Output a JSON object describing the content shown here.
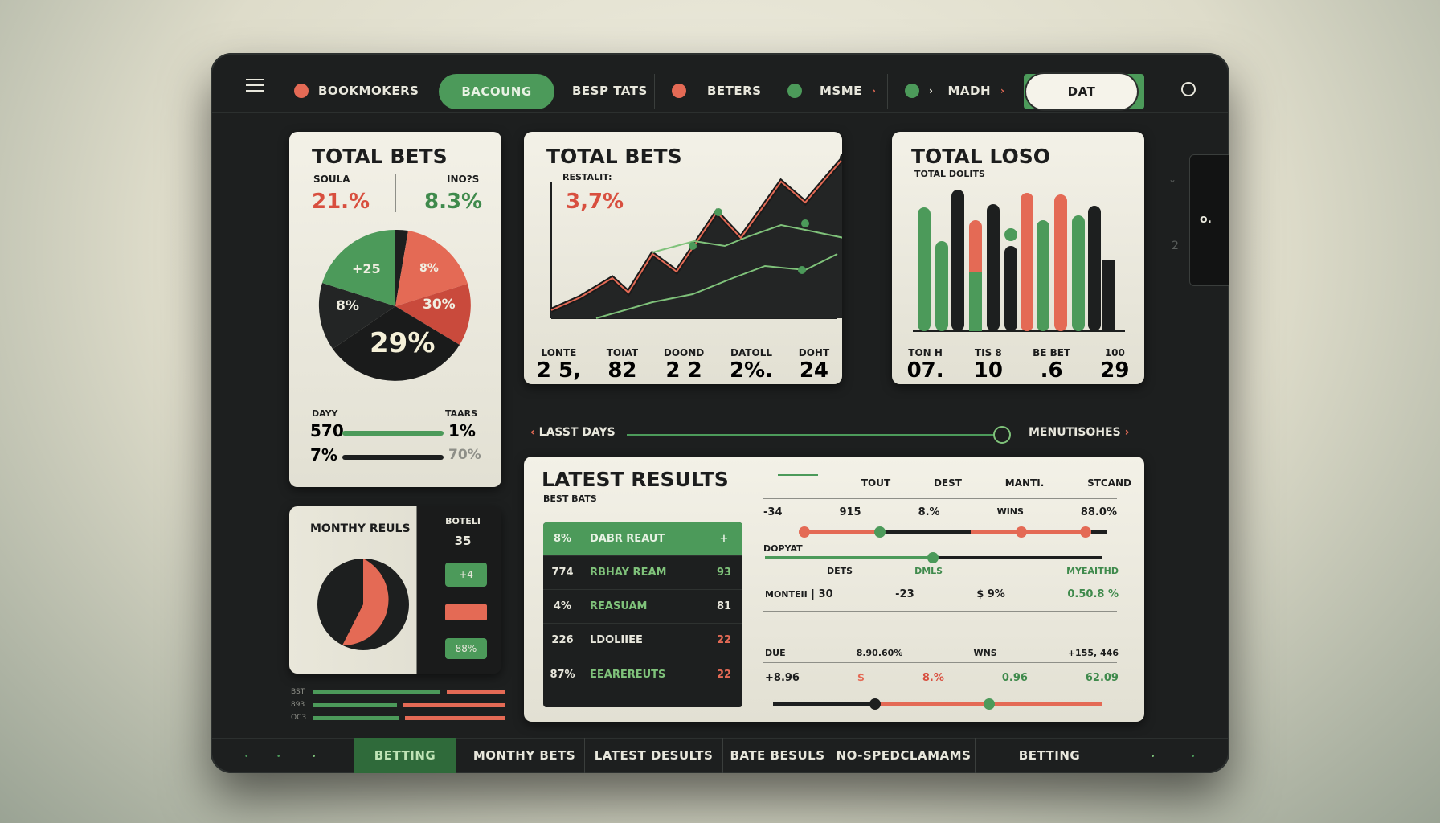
{
  "nav": {
    "items": [
      "BOOKMOKERS",
      "BACOUNG",
      "BESP TATS",
      "BETERS",
      "MSME",
      "MADH"
    ],
    "search_value": "DAT"
  },
  "pie_card": {
    "title": "TOTAL BETS",
    "left_label": "SOULA",
    "left_value": "21.%",
    "right_label": "INO?S",
    "right_value": "8.3%",
    "slices": [
      "+25",
      "8%",
      "8%",
      "30%",
      "29%"
    ],
    "footer_left_label": "DAYY",
    "footer_right_label": "TAARS",
    "rows": [
      {
        "left": "570",
        "right": "1%"
      },
      {
        "left": "7%",
        "right": "70%"
      }
    ]
  },
  "line_card": {
    "title": "TOTAL BETS",
    "subtitle": "RESTALIT:",
    "value": "3,7%",
    "stats": [
      {
        "label": "LONTE",
        "value": "2 5,"
      },
      {
        "label": "TOIAT",
        "value": "82"
      },
      {
        "label": "DOOND",
        "value": "2 2"
      },
      {
        "label": "DATOLL",
        "value": "2%."
      },
      {
        "label": "DOHT",
        "value": "24"
      }
    ]
  },
  "bar_card": {
    "title": "TOTAL LOSO",
    "subtitle": "TOTAL DOLITS",
    "stats": [
      {
        "label": "TON H",
        "value": "07."
      },
      {
        "label": "TIS 8",
        "value": "10"
      },
      {
        "label": "BE BET",
        "value": ".6"
      },
      {
        "label": "100",
        "value": "29"
      }
    ]
  },
  "slider": {
    "left_label": "LASST DAYS",
    "right_label": "MENUTISOHES"
  },
  "monthly_card": {
    "title": "MONTHY REULS",
    "side_label": "BOTELI",
    "side_value": "35",
    "side_items": [
      "+4",
      "",
      "88%"
    ]
  },
  "mini_bars": [
    "BST",
    "893",
    "OC3"
  ],
  "latest": {
    "title": "LATEST RESULTS",
    "subtitle": "BEST BATS",
    "rows": [
      {
        "pct": "8%",
        "name": "DABR REAUT",
        "val": "+"
      },
      {
        "pct": "774",
        "name": "RBHAY REAM",
        "val": "93"
      },
      {
        "pct": "4%",
        "name": "REASUAM",
        "val": "81"
      },
      {
        "pct": "226",
        "name": "LDOLIIEE",
        "val": "22"
      },
      {
        "pct": "87%",
        "name": "EEAREREUTS",
        "val": "22"
      }
    ],
    "headers": [
      "TOUT",
      "DEST",
      "MANTI.",
      "STCAND"
    ],
    "r1": {
      "a": "-34",
      "b": "915",
      "c": "8.%",
      "d": "WINS",
      "e": "88.0%"
    },
    "r2_label": "DOPYAT",
    "r3": {
      "a": "DETS",
      "b": "DMLS",
      "c": "MYEAITHD"
    },
    "r4": {
      "a": "MONTEII",
      "b": "30",
      "c": "-23",
      "d": "$",
      "e": "9%",
      "f": "0.50.8 %"
    },
    "r5": {
      "a": "DUE",
      "b": "8.90.60%",
      "c": "WNS",
      "d": "+155, 446"
    },
    "r6": {
      "a": "+8.96",
      "b": "$",
      "c": "8.%",
      "d": "0.96",
      "e": "62.09"
    }
  },
  "tabs": [
    "BETTING",
    "MONTHY BETS",
    "LATEST DESULTS",
    "BATE BESULS",
    "NO-SPEDCLAMAMS",
    "BETTING"
  ],
  "colors": {
    "red": "#e46a55",
    "green": "#4c9a5a",
    "dark": "#1d1f1f",
    "cream": "#f3f1e7"
  }
}
